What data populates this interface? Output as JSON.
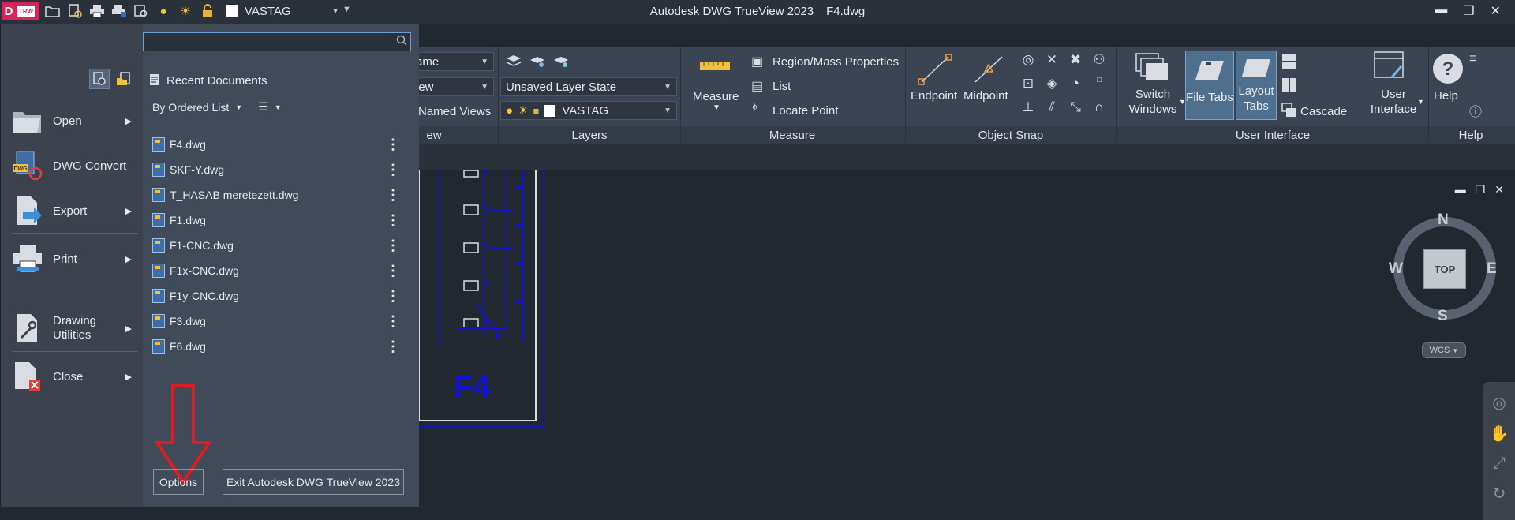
{
  "titlebar": {
    "app_badge": "D",
    "app_badge_small": "TRW",
    "layer_name": "VASTAG",
    "app_title": "Autodesk DWG TrueView 2023",
    "file_name": "F4.dwg",
    "minimize": "▬",
    "restore": "❐",
    "close": "✕"
  },
  "ribbon": {
    "view_panel": {
      "combo1": "ame",
      "combo2": "iew",
      "named_views": "Named Views",
      "label": "ew"
    },
    "layers_panel": {
      "layer_state": "Unsaved Layer State",
      "layer_name": "VASTAG",
      "label": "Layers"
    },
    "measure_panel": {
      "measure": "Measure",
      "region": "Region/Mass Properties",
      "list": "List",
      "locate": "Locate Point",
      "label": "Measure"
    },
    "osnap_panel": {
      "endpoint": "Endpoint",
      "midpoint": "Midpoint",
      "label": "Object Snap"
    },
    "ui_panel": {
      "switch_windows_1": "Switch",
      "switch_windows_2": "Windows",
      "file_tabs": "File Tabs",
      "layout_tabs_1": "Layout",
      "layout_tabs_2": "Tabs",
      "cascade": "Cascade",
      "user_interface_1": "User",
      "user_interface_2": "Interface",
      "label": "User Interface"
    },
    "help_panel": {
      "help": "Help",
      "label": "Help"
    }
  },
  "appmenu": {
    "search_placeholder": "",
    "left_items": [
      {
        "label": "Open"
      },
      {
        "label": "DWG Convert"
      },
      {
        "label": "Export"
      },
      {
        "label": "Print"
      },
      {
        "label_1": "Drawing",
        "label_2": "Utilities"
      },
      {
        "label": "Close"
      }
    ],
    "recent_title": "Recent Documents",
    "ordered_list": "By Ordered List",
    "documents": [
      "F4.dwg",
      "SKF-Y.dwg",
      "T_HASAB meretezett.dwg",
      "F1.dwg",
      "F1-CNC.dwg",
      "F1x-CNC.dwg",
      "F1y-CNC.dwg",
      "F3.dwg",
      "F6.dwg"
    ],
    "options": "Options",
    "exit": "Exit Autodesk DWG TrueView 2023"
  },
  "drawing": {
    "label": "F4"
  },
  "viewcube": {
    "top": "TOP",
    "n": "N",
    "s": "S",
    "e": "E",
    "w": "W",
    "wcs": "WCS"
  },
  "colors": {
    "accent_red": "#e01b24",
    "drawing_blue": "#1010d0",
    "panel_bg": "#3b4453"
  }
}
